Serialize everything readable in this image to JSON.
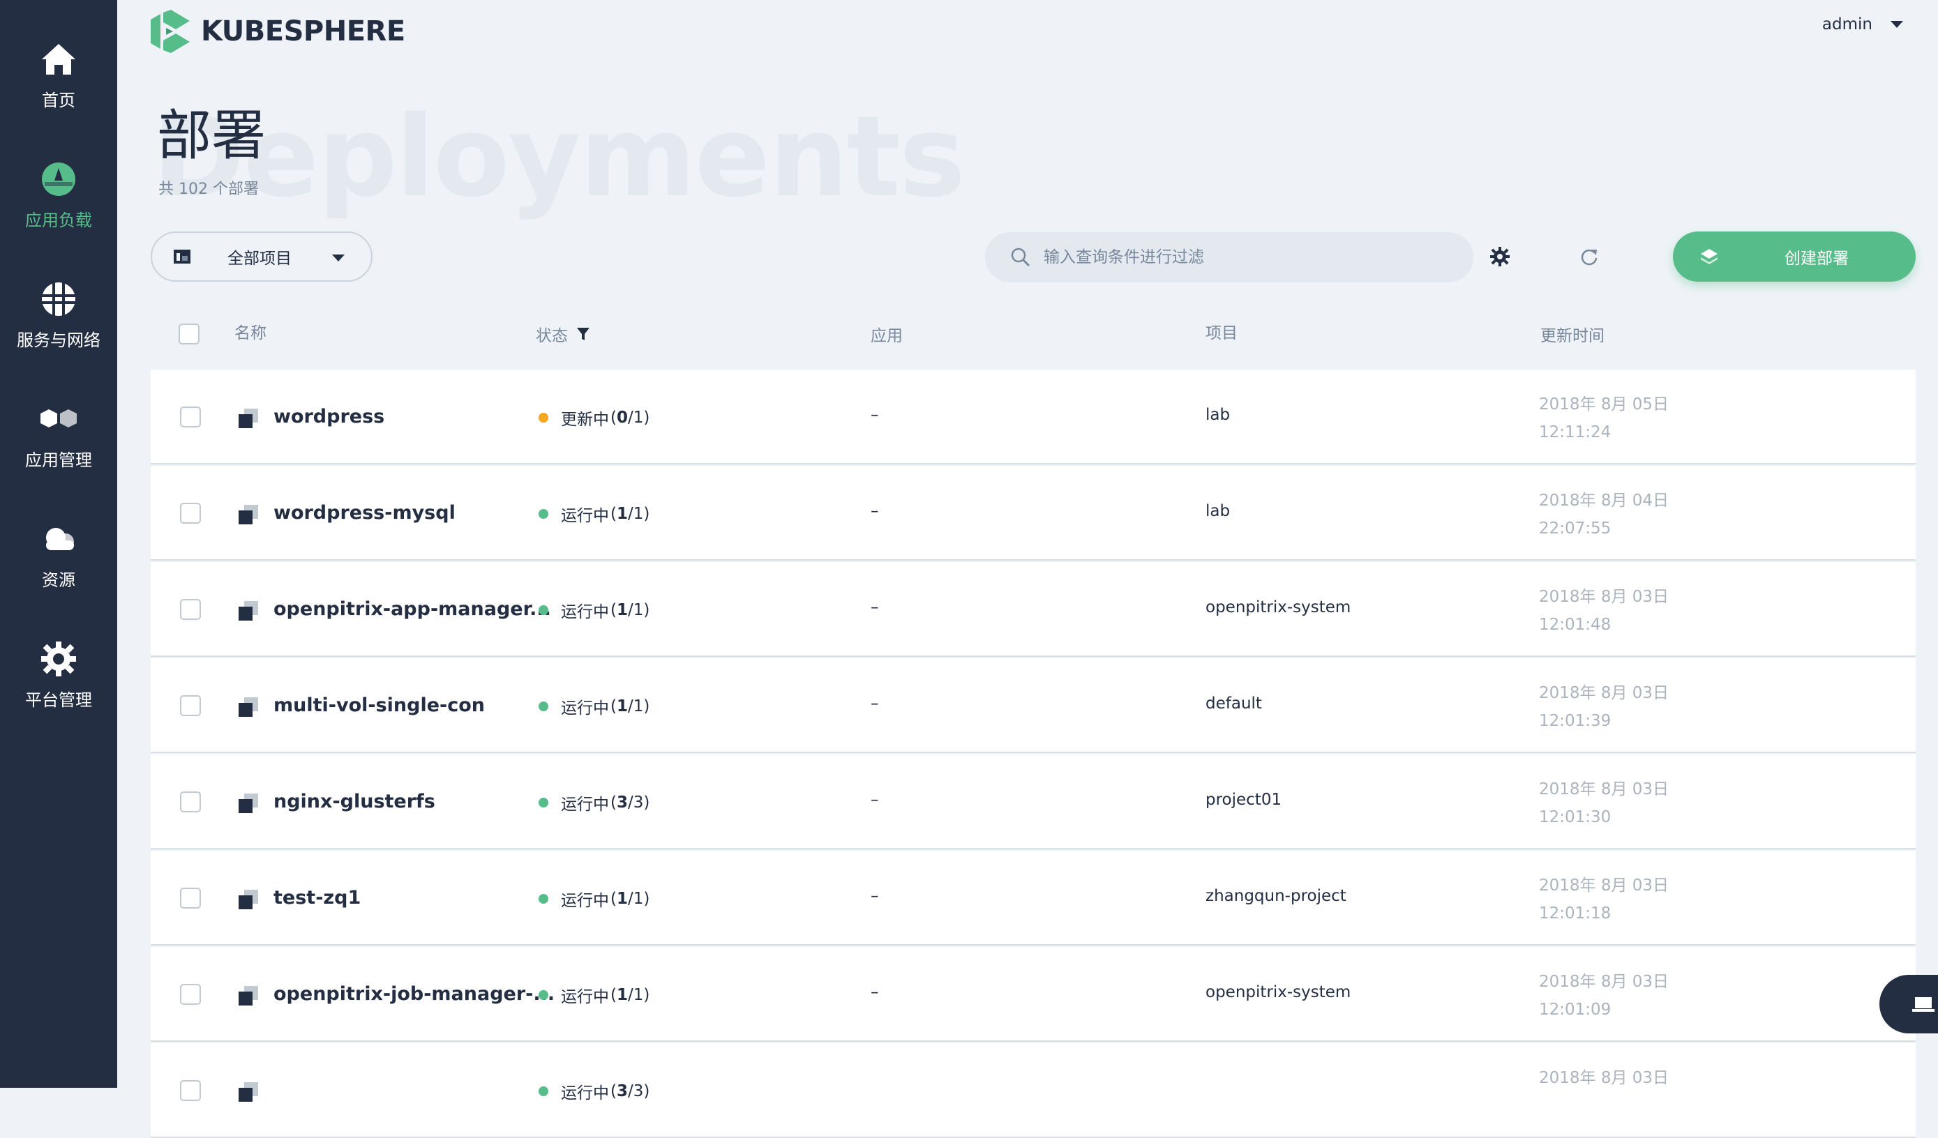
{
  "sidebar": {
    "items": [
      {
        "label": "首页",
        "icon": "home-icon"
      },
      {
        "label": "应用负载",
        "icon": "gauge-icon"
      },
      {
        "label": "服务与网络",
        "icon": "network-icon"
      },
      {
        "label": "应用管理",
        "icon": "hexagons-icon"
      },
      {
        "label": "资源",
        "icon": "cloud-icon"
      },
      {
        "label": "平台管理",
        "icon": "gear-icon"
      }
    ],
    "active_color": "#55bc8a"
  },
  "header": {
    "logo_text": "KUBESPHERE",
    "user": "admin"
  },
  "page": {
    "title": "部署",
    "bg_title": "Deployments",
    "subtitle": "共 102 个部署"
  },
  "toolbar": {
    "project_select": "全部项目",
    "search_placeholder": "输入查询条件进行过滤",
    "create_label": "创建部署"
  },
  "table": {
    "headers": {
      "name": "名称",
      "status": "状态",
      "app": "应用",
      "project": "项目",
      "updated": "更新时间"
    },
    "rows": [
      {
        "name": "wordpress",
        "status": "更新中",
        "count_bold": "0",
        "count_rest": "/1",
        "status_color": "#f5a623",
        "app": "–",
        "project": "lab",
        "date": "2018年 8月 05日",
        "time": "12:11:24"
      },
      {
        "name": "wordpress-mysql",
        "status": "运行中",
        "count_bold": "1",
        "count_rest": "/1",
        "status_color": "#55bc8a",
        "app": "–",
        "project": "lab",
        "date": "2018年 8月 04日",
        "time": "22:07:55"
      },
      {
        "name": "openpitrix-app-manager...",
        "status": "运行中",
        "count_bold": "1",
        "count_rest": "/1",
        "status_color": "#55bc8a",
        "app": "–",
        "project": "openpitrix-system",
        "date": "2018年 8月 03日",
        "time": "12:01:48"
      },
      {
        "name": "multi-vol-single-con",
        "status": "运行中",
        "count_bold": "1",
        "count_rest": "/1",
        "status_color": "#55bc8a",
        "app": "–",
        "project": "default",
        "date": "2018年 8月 03日",
        "time": "12:01:39"
      },
      {
        "name": "nginx-glusterfs",
        "status": "运行中",
        "count_bold": "3",
        "count_rest": "/3",
        "status_color": "#55bc8a",
        "app": "–",
        "project": "project01",
        "date": "2018年 8月 03日",
        "time": "12:01:30"
      },
      {
        "name": "test-zq1",
        "status": "运行中",
        "count_bold": "1",
        "count_rest": "/1",
        "status_color": "#55bc8a",
        "app": "–",
        "project": "zhangqun-project",
        "date": "2018年 8月 03日",
        "time": "12:01:18"
      },
      {
        "name": "openpitrix-job-manager-...",
        "status": "运行中",
        "count_bold": "1",
        "count_rest": "/1",
        "status_color": "#55bc8a",
        "app": "–",
        "project": "openpitrix-system",
        "date": "2018年 8月 03日",
        "time": "12:01:09"
      },
      {
        "name": "",
        "status": "运行中",
        "count_bold": "3",
        "count_rest": "/3",
        "status_color": "#55bc8a",
        "app": "",
        "project": "",
        "date": "2018年 8月 03日",
        "time": ""
      }
    ]
  }
}
